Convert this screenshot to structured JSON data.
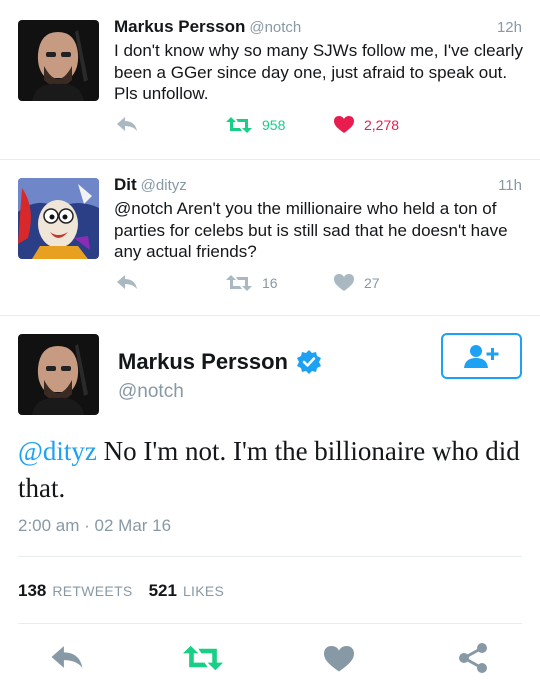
{
  "colors": {
    "blue": "#1da1f2",
    "green": "#19cf86",
    "red": "#e81c4f",
    "gray": "#aab8c2",
    "text_gray": "#8899a6"
  },
  "tweets": [
    {
      "name": "Markus Persson",
      "handle": "@notch",
      "time": "12h",
      "text_lines": [
        "I don't know why so many SJWs follow me, I've clearly",
        "been a GGer since day one, just afraid to speak out.",
        "Pls unfollow."
      ],
      "retweets": "958",
      "likes": "2,278",
      "liked": true,
      "retweeted": true
    },
    {
      "name": "Dit",
      "handle": "@dityz",
      "time": "11h",
      "text_lines": [
        "@notch Aren't you the millionaire who held a ton of",
        "parties for celebs but is still sad that he doesn't have",
        "any actual friends?"
      ],
      "retweets": "16",
      "likes": "27",
      "liked": false,
      "retweeted": false
    }
  ],
  "main": {
    "name": "Markus Persson",
    "handle": "@notch",
    "mention": "@dityz",
    "text": " No I'm not. I'm the billionaire who did that.",
    "timestamp": "2:00 am · 02 Mar 16",
    "retweet_count": "138",
    "retweet_label": "RETWEETS",
    "like_count": "521",
    "like_label": "LIKES"
  },
  "icons": {
    "reply": "reply-icon",
    "retweet": "retweet-icon",
    "like": "heart-icon",
    "share": "share-icon",
    "verified": "verified-badge-icon",
    "follow": "follow-user-icon"
  }
}
